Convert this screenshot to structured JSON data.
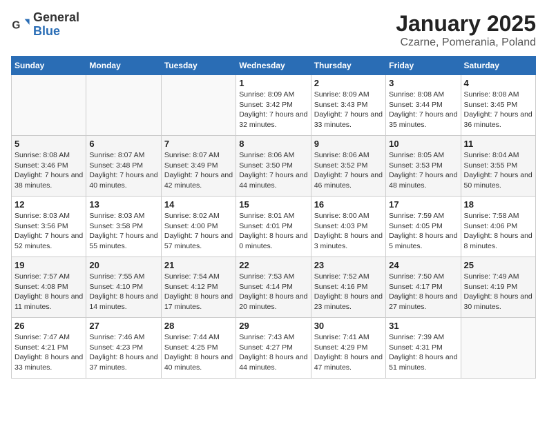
{
  "logo": {
    "general": "General",
    "blue": "Blue"
  },
  "title": "January 2025",
  "subtitle": "Czarne, Pomerania, Poland",
  "weekdays": [
    "Sunday",
    "Monday",
    "Tuesday",
    "Wednesday",
    "Thursday",
    "Friday",
    "Saturday"
  ],
  "weeks": [
    [
      {
        "day": "",
        "info": ""
      },
      {
        "day": "",
        "info": ""
      },
      {
        "day": "",
        "info": ""
      },
      {
        "day": "1",
        "info": "Sunrise: 8:09 AM\nSunset: 3:42 PM\nDaylight: 7 hours and 32 minutes."
      },
      {
        "day": "2",
        "info": "Sunrise: 8:09 AM\nSunset: 3:43 PM\nDaylight: 7 hours and 33 minutes."
      },
      {
        "day": "3",
        "info": "Sunrise: 8:08 AM\nSunset: 3:44 PM\nDaylight: 7 hours and 35 minutes."
      },
      {
        "day": "4",
        "info": "Sunrise: 8:08 AM\nSunset: 3:45 PM\nDaylight: 7 hours and 36 minutes."
      }
    ],
    [
      {
        "day": "5",
        "info": "Sunrise: 8:08 AM\nSunset: 3:46 PM\nDaylight: 7 hours and 38 minutes."
      },
      {
        "day": "6",
        "info": "Sunrise: 8:07 AM\nSunset: 3:48 PM\nDaylight: 7 hours and 40 minutes."
      },
      {
        "day": "7",
        "info": "Sunrise: 8:07 AM\nSunset: 3:49 PM\nDaylight: 7 hours and 42 minutes."
      },
      {
        "day": "8",
        "info": "Sunrise: 8:06 AM\nSunset: 3:50 PM\nDaylight: 7 hours and 44 minutes."
      },
      {
        "day": "9",
        "info": "Sunrise: 8:06 AM\nSunset: 3:52 PM\nDaylight: 7 hours and 46 minutes."
      },
      {
        "day": "10",
        "info": "Sunrise: 8:05 AM\nSunset: 3:53 PM\nDaylight: 7 hours and 48 minutes."
      },
      {
        "day": "11",
        "info": "Sunrise: 8:04 AM\nSunset: 3:55 PM\nDaylight: 7 hours and 50 minutes."
      }
    ],
    [
      {
        "day": "12",
        "info": "Sunrise: 8:03 AM\nSunset: 3:56 PM\nDaylight: 7 hours and 52 minutes."
      },
      {
        "day": "13",
        "info": "Sunrise: 8:03 AM\nSunset: 3:58 PM\nDaylight: 7 hours and 55 minutes."
      },
      {
        "day": "14",
        "info": "Sunrise: 8:02 AM\nSunset: 4:00 PM\nDaylight: 7 hours and 57 minutes."
      },
      {
        "day": "15",
        "info": "Sunrise: 8:01 AM\nSunset: 4:01 PM\nDaylight: 8 hours and 0 minutes."
      },
      {
        "day": "16",
        "info": "Sunrise: 8:00 AM\nSunset: 4:03 PM\nDaylight: 8 hours and 3 minutes."
      },
      {
        "day": "17",
        "info": "Sunrise: 7:59 AM\nSunset: 4:05 PM\nDaylight: 8 hours and 5 minutes."
      },
      {
        "day": "18",
        "info": "Sunrise: 7:58 AM\nSunset: 4:06 PM\nDaylight: 8 hours and 8 minutes."
      }
    ],
    [
      {
        "day": "19",
        "info": "Sunrise: 7:57 AM\nSunset: 4:08 PM\nDaylight: 8 hours and 11 minutes."
      },
      {
        "day": "20",
        "info": "Sunrise: 7:55 AM\nSunset: 4:10 PM\nDaylight: 8 hours and 14 minutes."
      },
      {
        "day": "21",
        "info": "Sunrise: 7:54 AM\nSunset: 4:12 PM\nDaylight: 8 hours and 17 minutes."
      },
      {
        "day": "22",
        "info": "Sunrise: 7:53 AM\nSunset: 4:14 PM\nDaylight: 8 hours and 20 minutes."
      },
      {
        "day": "23",
        "info": "Sunrise: 7:52 AM\nSunset: 4:16 PM\nDaylight: 8 hours and 23 minutes."
      },
      {
        "day": "24",
        "info": "Sunrise: 7:50 AM\nSunset: 4:17 PM\nDaylight: 8 hours and 27 minutes."
      },
      {
        "day": "25",
        "info": "Sunrise: 7:49 AM\nSunset: 4:19 PM\nDaylight: 8 hours and 30 minutes."
      }
    ],
    [
      {
        "day": "26",
        "info": "Sunrise: 7:47 AM\nSunset: 4:21 PM\nDaylight: 8 hours and 33 minutes."
      },
      {
        "day": "27",
        "info": "Sunrise: 7:46 AM\nSunset: 4:23 PM\nDaylight: 8 hours and 37 minutes."
      },
      {
        "day": "28",
        "info": "Sunrise: 7:44 AM\nSunset: 4:25 PM\nDaylight: 8 hours and 40 minutes."
      },
      {
        "day": "29",
        "info": "Sunrise: 7:43 AM\nSunset: 4:27 PM\nDaylight: 8 hours and 44 minutes."
      },
      {
        "day": "30",
        "info": "Sunrise: 7:41 AM\nSunset: 4:29 PM\nDaylight: 8 hours and 47 minutes."
      },
      {
        "day": "31",
        "info": "Sunrise: 7:39 AM\nSunset: 4:31 PM\nDaylight: 8 hours and 51 minutes."
      },
      {
        "day": "",
        "info": ""
      }
    ]
  ]
}
